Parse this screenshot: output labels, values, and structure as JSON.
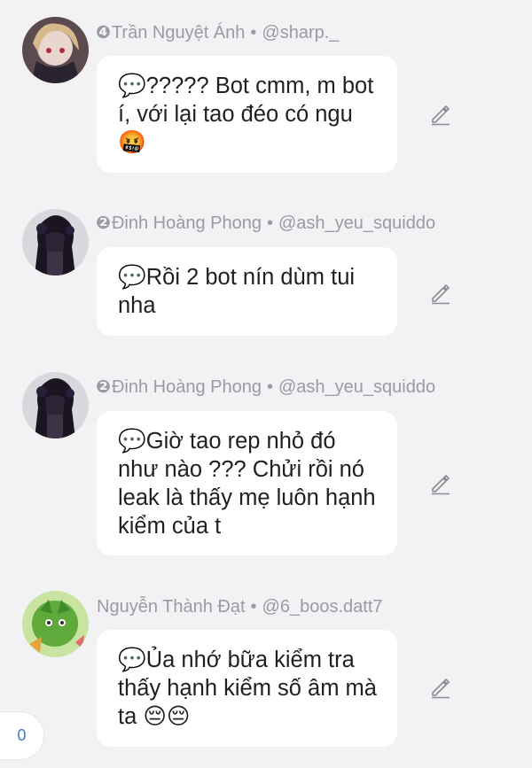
{
  "comments": [
    {
      "rank": "❹",
      "name": "Trần Nguyệt Ánh",
      "handle": "@sharp._",
      "message": "💬????? Bot cmm, m bot í, với lại tao đéo có ngu 🤬",
      "avatar_icon": "anime-girl-avatar"
    },
    {
      "rank": "❷",
      "name": "Đinh Hoàng Phong",
      "handle": "@ash_yeu_squiddo",
      "message": "💬Rồi 2 bot nín dùm tui nha",
      "avatar_icon": "dark-figure-avatar"
    },
    {
      "rank": "❷",
      "name": "Đinh Hoàng Phong",
      "handle": "@ash_yeu_squiddo",
      "message": "💬Giờ tao rep nhỏ đó như nào ??? Chửi rồi nó leak là thấy mẹ luôn hạnh kiểm của t",
      "avatar_icon": "dark-figure-avatar"
    },
    {
      "rank": "",
      "name": "Nguyễn Thành Đạt",
      "handle": "@6_boos.datt7",
      "message": "💬Ủa nhớ bữa kiểm tra thấy hạnh kiểm số âm mà ta 😔😔",
      "avatar_icon": "green-character-avatar"
    }
  ],
  "separator": "•",
  "count_badge": "0",
  "colors": {
    "background": "#f2f2f4",
    "bubble": "#ffffff",
    "meta_text": "#9a9aa2",
    "badge_text": "#3a7bd5"
  }
}
